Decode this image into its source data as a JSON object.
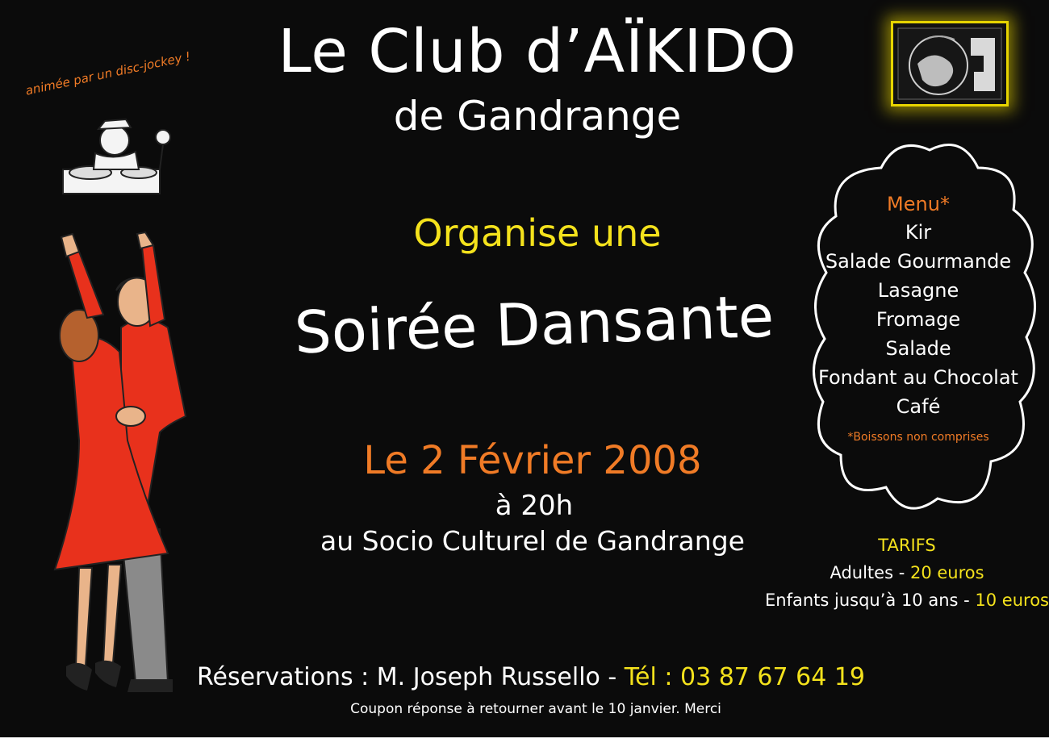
{
  "header": {
    "title_line1": "Le Club d’AÏKIDO",
    "title_line2": "de Gandrange"
  },
  "dj": {
    "caption": "animée par un disc-jockey !",
    "icon": "dj-illustration"
  },
  "event": {
    "organise": "Organise une",
    "name": "Soirée Dansante",
    "date": "Le 2 Février 2008",
    "time": "à 20h",
    "venue": "au Socio Culturel de Gandrange"
  },
  "menu": {
    "title": "Menu*",
    "items": [
      "Kir",
      "Salade Gourmande",
      "Lasagne",
      "Fromage",
      "Salade",
      "Fondant au Chocolat",
      "Café"
    ],
    "note": "*Boissons non comprises"
  },
  "tarifs": {
    "title": "TARIFS",
    "adult_label": "Adultes - ",
    "adult_price": "20 euros",
    "child_label": "Enfants jusqu’à 10 ans - ",
    "child_price": "10 euros"
  },
  "reservation": {
    "text": "Réservations : M. Joseph Russello - ",
    "tel": "Tél : 03 87 67 64 19",
    "coupon": "Coupon réponse à retourner avant le 10 janvier. Merci"
  },
  "colors": {
    "background": "#0b0b0b",
    "yellow": "#f4e21c",
    "orange": "#f07b26",
    "dress_red": "#e8311c"
  },
  "logo": {
    "icon": "aikido-club-logo"
  }
}
